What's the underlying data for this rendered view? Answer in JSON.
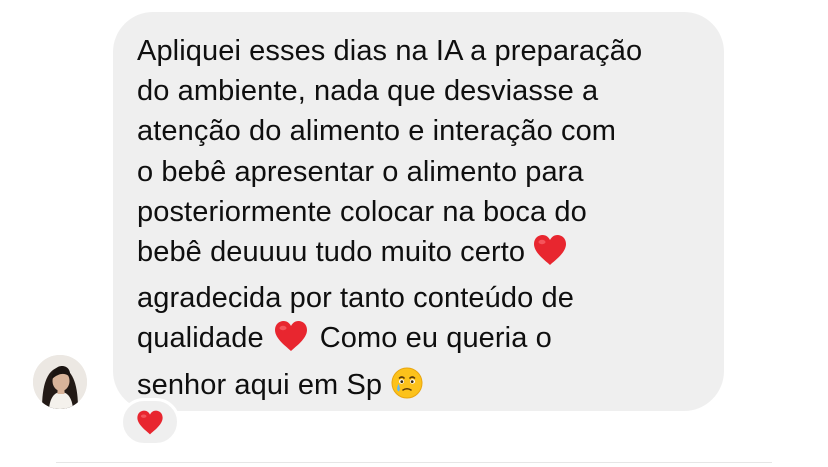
{
  "message": {
    "sender_avatar_icon": "profile-photo-icon",
    "lines": [
      "Apliquei esses dias na IA a preparação",
      "do ambiente, nada que desviasse a",
      "atenção do alimento e interação com",
      "o bebê apresentar o alimento para",
      "posteriormente colocar na boca do",
      "bebê deuuuu tudo muito certo",
      "agradecida por tanto conteúdo de",
      "qualidade",
      "Como eu queria o",
      "senhor aqui em Sp"
    ],
    "inline_emojis": [
      "red-heart-icon",
      "red-heart-icon",
      "face-holding-back-tears-icon"
    ],
    "bubble_color": "#efefef",
    "text_color": "#0f0f0f"
  },
  "reaction": {
    "icon": "red-heart-icon",
    "color": "#e8262f"
  }
}
